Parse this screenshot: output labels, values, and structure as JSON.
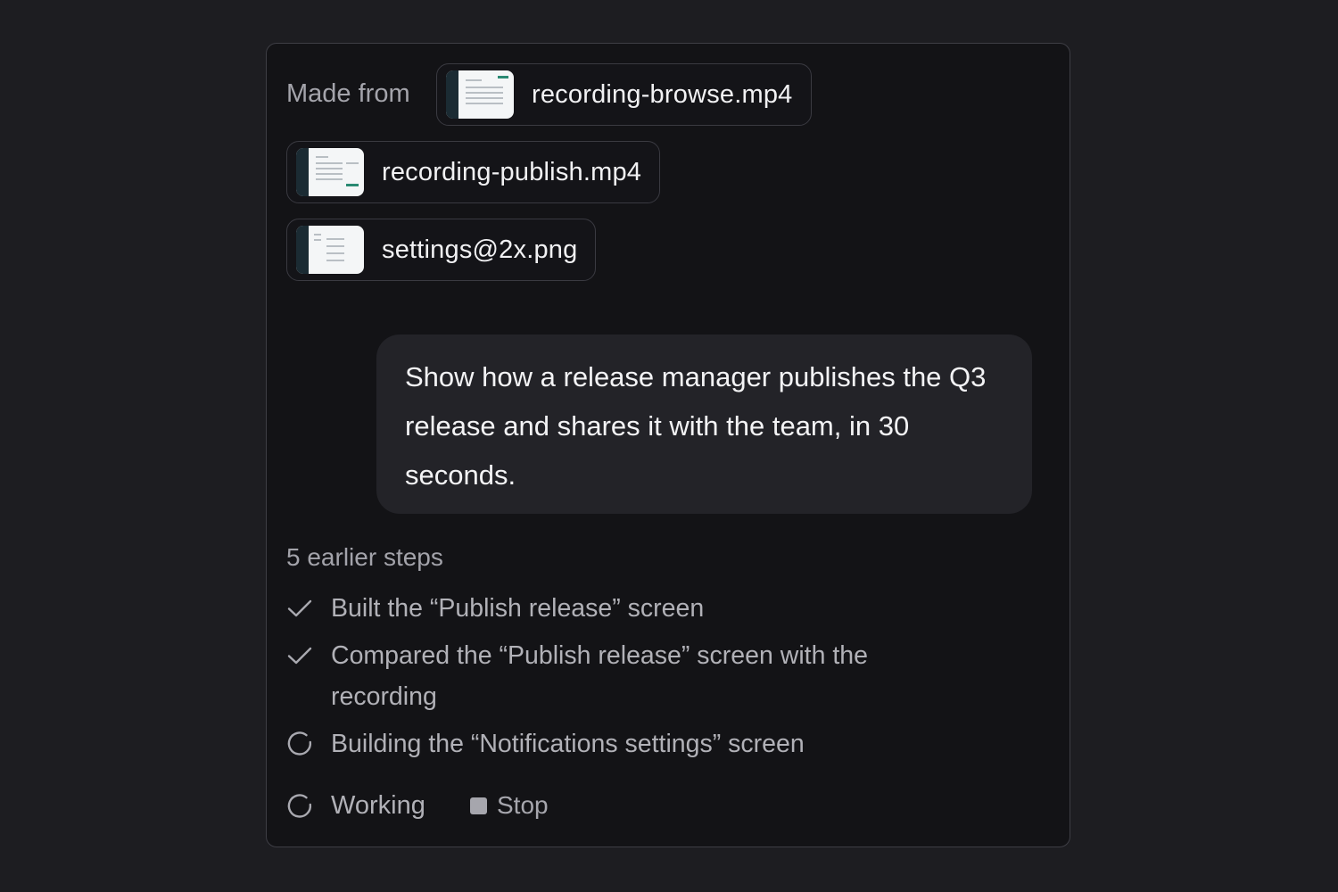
{
  "panel": {
    "made_from_label": "Made from",
    "files": [
      {
        "name": "recording-browse.mp4"
      },
      {
        "name": "recording-publish.mp4"
      },
      {
        "name": "settings@2x.png"
      }
    ],
    "prompt": "Show how a release manager publishes the Q3 release and shares it with the team, in 30 seconds.",
    "earlier_steps": "5 earlier steps",
    "steps": [
      {
        "status": "done",
        "icon": "check-icon",
        "label": "Built the “Publish release” screen"
      },
      {
        "status": "done",
        "icon": "check-icon",
        "label": "Compared the “Publish release” screen with the recording"
      },
      {
        "status": "in-progress",
        "icon": "spinner-icon",
        "label": "Building the “Notifications settings” screen"
      }
    ],
    "working_label": "Working",
    "stop_label": "Stop"
  },
  "colors": {
    "background": "#1d1d21",
    "panel": "#131316",
    "bubble": "#232328",
    "accent": "#2a8a73"
  }
}
